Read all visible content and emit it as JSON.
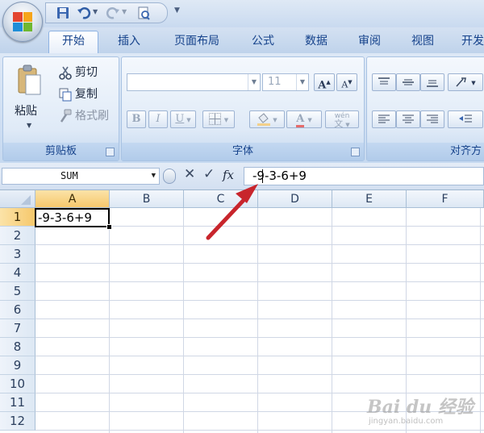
{
  "tabs": [
    {
      "label": "开始",
      "active": true
    },
    {
      "label": "插入"
    },
    {
      "label": "页面布局"
    },
    {
      "label": "公式"
    },
    {
      "label": "数据"
    },
    {
      "label": "审阅"
    },
    {
      "label": "视图"
    },
    {
      "label": "开发"
    }
  ],
  "clipboard": {
    "paste_label": "粘贴",
    "cut_label": "剪切",
    "copy_label": "复制",
    "format_painter_label": "格式刷",
    "group_label": "剪贴板"
  },
  "font": {
    "font_name": "",
    "font_size": "11",
    "bold": "B",
    "italic": "I",
    "underline": "U",
    "grow_font": "A",
    "shrink_font": "A",
    "phonetic": "wén",
    "group_label": "字体"
  },
  "alignment": {
    "group_label": "对齐方"
  },
  "formula_bar": {
    "name_box": "SUM",
    "formula": "-9-3-6+9",
    "fx_label": "fx"
  },
  "columns": [
    "A",
    "B",
    "C",
    "D",
    "E",
    "F"
  ],
  "rows": [
    "1",
    "2",
    "3",
    "4",
    "5",
    "6",
    "7",
    "8",
    "9",
    "10",
    "11",
    "12"
  ],
  "active_cell": {
    "column": "A",
    "row": "1",
    "value": "-9-3-6+9"
  },
  "annotation": {
    "arrow_color": "#c8252c"
  },
  "watermark": {
    "text": "Bai du 经验",
    "url": "jingyan.baidu.com"
  },
  "colors": {
    "ribbon_text": "#15428b",
    "selected_header": "#f6c86c",
    "grid_line": "#d0d7e5"
  }
}
